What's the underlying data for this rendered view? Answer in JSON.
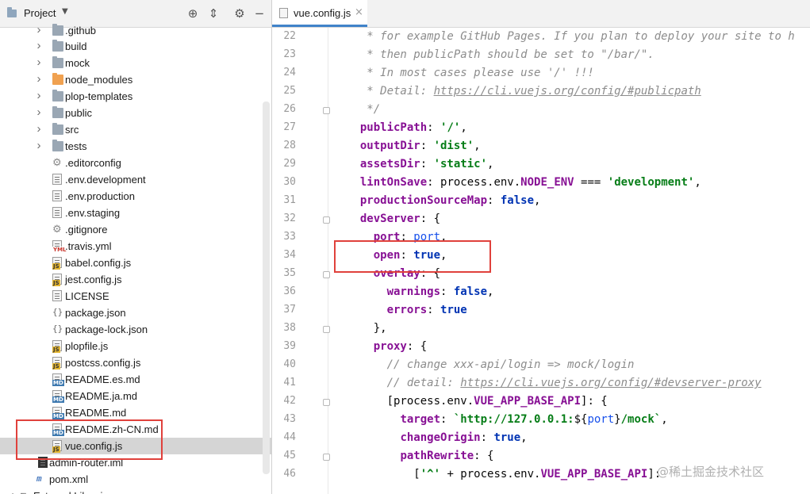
{
  "project_panel": {
    "title": "Project",
    "tools": [
      "globe-icon",
      "collapse-icon",
      "gear-icon",
      "minimize-icon"
    ]
  },
  "tree": [
    {
      "label": ".github",
      "type": "folder",
      "expandable": true
    },
    {
      "label": "build",
      "type": "folder",
      "expandable": true
    },
    {
      "label": "mock",
      "type": "folder",
      "expandable": true
    },
    {
      "label": "node_modules",
      "type": "folder-excluded",
      "expandable": true
    },
    {
      "label": "plop-templates",
      "type": "folder",
      "expandable": true
    },
    {
      "label": "public",
      "type": "folder",
      "expandable": true
    },
    {
      "label": "src",
      "type": "folder",
      "expandable": true
    },
    {
      "label": "tests",
      "type": "folder",
      "expandable": true
    },
    {
      "label": ".editorconfig",
      "type": "config"
    },
    {
      "label": ".env.development",
      "type": "text"
    },
    {
      "label": ".env.production",
      "type": "text"
    },
    {
      "label": ".env.staging",
      "type": "text"
    },
    {
      "label": ".gitignore",
      "type": "gitignore"
    },
    {
      "label": ".travis.yml",
      "type": "yml"
    },
    {
      "label": "babel.config.js",
      "type": "js"
    },
    {
      "label": "jest.config.js",
      "type": "js"
    },
    {
      "label": "LICENSE",
      "type": "text"
    },
    {
      "label": "package.json",
      "type": "json"
    },
    {
      "label": "package-lock.json",
      "type": "json"
    },
    {
      "label": "plopfile.js",
      "type": "js"
    },
    {
      "label": "postcss.config.js",
      "type": "js"
    },
    {
      "label": "README.es.md",
      "type": "md"
    },
    {
      "label": "README.ja.md",
      "type": "md"
    },
    {
      "label": "README.md",
      "type": "md"
    },
    {
      "label": "README.zh-CN.md",
      "type": "md"
    },
    {
      "label": "vue.config.js",
      "type": "js",
      "selected": true
    },
    {
      "label": "admin-router.iml",
      "type": "iml"
    },
    {
      "label": "pom.xml",
      "type": "maven"
    },
    {
      "label": "External Libraries",
      "type": "lib"
    }
  ],
  "editor": {
    "tab_label": "vue.config.js",
    "tab_close": "×",
    "line_numbers": [
      "22",
      "23",
      "24",
      "25",
      "26",
      "27",
      "28",
      "29",
      "30",
      "31",
      "32",
      "33",
      "34",
      "35",
      "36",
      "37",
      "38",
      "39",
      "40",
      "41",
      "42",
      "43",
      "44",
      "45",
      "46"
    ]
  },
  "code_lines": [
    [
      {
        "t": "   * for example GitHub Pages. If you plan to deploy your site to h",
        "c": "cm"
      }
    ],
    [
      {
        "t": "   * then publicPath should be set to \"/bar/\".",
        "c": "cm"
      }
    ],
    [
      {
        "t": "   * In most cases please use '/' !!!",
        "c": "cm"
      }
    ],
    [
      {
        "t": "   * Detail: ",
        "c": "cm"
      },
      {
        "t": "https://cli.vuejs.org/config/#publicpath",
        "c": "cm-link"
      }
    ],
    [
      {
        "t": "   */",
        "c": "cm"
      }
    ],
    [
      {
        "t": "  ",
        "c": "plain"
      },
      {
        "t": "publicPath",
        "c": "prop"
      },
      {
        "t": ": ",
        "c": "plain"
      },
      {
        "t": "'/'",
        "c": "str"
      },
      {
        "t": ",",
        "c": "plain"
      }
    ],
    [
      {
        "t": "  ",
        "c": "plain"
      },
      {
        "t": "outputDir",
        "c": "prop"
      },
      {
        "t": ": ",
        "c": "plain"
      },
      {
        "t": "'dist'",
        "c": "str"
      },
      {
        "t": ",",
        "c": "plain"
      }
    ],
    [
      {
        "t": "  ",
        "c": "plain"
      },
      {
        "t": "assetsDir",
        "c": "prop"
      },
      {
        "t": ": ",
        "c": "plain"
      },
      {
        "t": "'static'",
        "c": "str"
      },
      {
        "t": ",",
        "c": "plain"
      }
    ],
    [
      {
        "t": "  ",
        "c": "plain"
      },
      {
        "t": "lintOnSave",
        "c": "prop"
      },
      {
        "t": ": process.env.",
        "c": "plain"
      },
      {
        "t": "NODE_ENV",
        "c": "prop"
      },
      {
        "t": " === ",
        "c": "plain"
      },
      {
        "t": "'development'",
        "c": "str"
      },
      {
        "t": ",",
        "c": "plain"
      }
    ],
    [
      {
        "t": "  ",
        "c": "plain"
      },
      {
        "t": "productionSourceMap",
        "c": "prop"
      },
      {
        "t": ": ",
        "c": "plain"
      },
      {
        "t": "false",
        "c": "kw"
      },
      {
        "t": ",",
        "c": "plain"
      }
    ],
    [
      {
        "t": "  ",
        "c": "plain"
      },
      {
        "t": "devServer",
        "c": "prop"
      },
      {
        "t": ": {",
        "c": "plain"
      }
    ],
    [
      {
        "t": "    ",
        "c": "plain"
      },
      {
        "t": "port",
        "c": "prop"
      },
      {
        "t": ": ",
        "c": "plain"
      },
      {
        "t": "port",
        "c": "var"
      },
      {
        "t": ",",
        "c": "plain"
      }
    ],
    [
      {
        "t": "    ",
        "c": "plain"
      },
      {
        "t": "open",
        "c": "prop"
      },
      {
        "t": ": ",
        "c": "plain"
      },
      {
        "t": "true",
        "c": "kw"
      },
      {
        "t": ",",
        "c": "plain"
      }
    ],
    [
      {
        "t": "    ",
        "c": "plain"
      },
      {
        "t": "overlay",
        "c": "prop"
      },
      {
        "t": ": {",
        "c": "plain"
      }
    ],
    [
      {
        "t": "      ",
        "c": "plain"
      },
      {
        "t": "warnings",
        "c": "prop"
      },
      {
        "t": ": ",
        "c": "plain"
      },
      {
        "t": "false",
        "c": "kw"
      },
      {
        "t": ",",
        "c": "plain"
      }
    ],
    [
      {
        "t": "      ",
        "c": "plain"
      },
      {
        "t": "errors",
        "c": "prop"
      },
      {
        "t": ": ",
        "c": "plain"
      },
      {
        "t": "true",
        "c": "kw"
      }
    ],
    [
      {
        "t": "    },",
        "c": "plain"
      }
    ],
    [
      {
        "t": "    ",
        "c": "plain"
      },
      {
        "t": "proxy",
        "c": "prop"
      },
      {
        "t": ": {",
        "c": "plain"
      }
    ],
    [
      {
        "t": "      // change xxx-api/login => mock/login",
        "c": "cm"
      }
    ],
    [
      {
        "t": "      // detail: ",
        "c": "cm"
      },
      {
        "t": "https://cli.vuejs.org/config/#devserver-proxy",
        "c": "cm-link"
      }
    ],
    [
      {
        "t": "      [process.env.",
        "c": "plain"
      },
      {
        "t": "VUE_APP_BASE_API",
        "c": "prop"
      },
      {
        "t": "]: {",
        "c": "plain"
      }
    ],
    [
      {
        "t": "        ",
        "c": "plain"
      },
      {
        "t": "target",
        "c": "prop"
      },
      {
        "t": ": ",
        "c": "plain"
      },
      {
        "t": "`http://127.0.0.1:",
        "c": "str"
      },
      {
        "t": "${",
        "c": "plain"
      },
      {
        "t": "port",
        "c": "var"
      },
      {
        "t": "}",
        "c": "plain"
      },
      {
        "t": "/mock`",
        "c": "str"
      },
      {
        "t": ",",
        "c": "plain"
      }
    ],
    [
      {
        "t": "        ",
        "c": "plain"
      },
      {
        "t": "changeOrigin",
        "c": "prop"
      },
      {
        "t": ": ",
        "c": "plain"
      },
      {
        "t": "true",
        "c": "kw"
      },
      {
        "t": ",",
        "c": "plain"
      }
    ],
    [
      {
        "t": "        ",
        "c": "plain"
      },
      {
        "t": "pathRewrite",
        "c": "prop"
      },
      {
        "t": ": {",
        "c": "plain"
      }
    ],
    [
      {
        "t": "          [",
        "c": "plain"
      },
      {
        "t": "'^'",
        "c": "str"
      },
      {
        "t": " + process.env.",
        "c": "plain"
      },
      {
        "t": "VUE_APP_BASE_API",
        "c": "prop"
      },
      {
        "t": "]:",
        "c": "plain"
      }
    ]
  ],
  "watermark": "@稀土掘金技术社区",
  "colors": {
    "highlight_box": "#e0413c",
    "selection": "#d5d5d5",
    "tab_underline": "#4083c9"
  }
}
